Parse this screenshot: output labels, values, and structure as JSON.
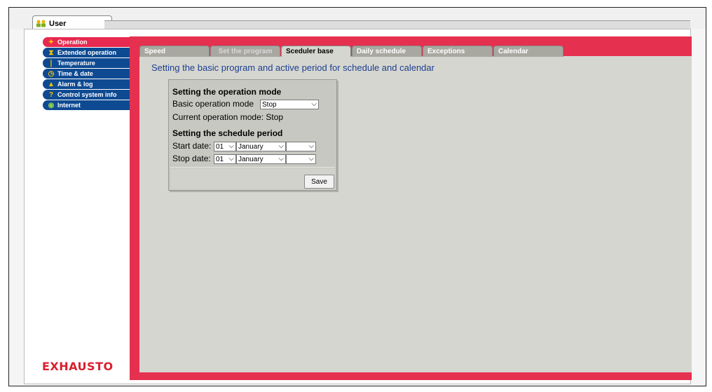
{
  "window": {
    "tab_label": "User"
  },
  "sidebar": {
    "items": [
      {
        "label": "Operation",
        "icon": "tools-icon",
        "glyph": "🔧"
      },
      {
        "label": "Extended operation",
        "icon": "hourglass-icon",
        "glyph": "⧗"
      },
      {
        "label": "Temperature",
        "icon": "thermometer-icon",
        "glyph": "🌡"
      },
      {
        "label": "Time & date",
        "icon": "clock-icon",
        "glyph": "◷"
      },
      {
        "label": "Alarm & log",
        "icon": "bell-icon",
        "glyph": "🔔"
      },
      {
        "label": "Control system info",
        "icon": "question-icon",
        "glyph": "?"
      },
      {
        "label": "Internet",
        "icon": "globe-icon",
        "glyph": "◉"
      }
    ]
  },
  "tabs": [
    {
      "label": "Speed"
    },
    {
      "label": "Set the program"
    },
    {
      "label": "Sceduler base"
    },
    {
      "label": "Daily schedule"
    },
    {
      "label": "Exceptions"
    },
    {
      "label": "Calendar"
    }
  ],
  "page": {
    "title": "Setting the basic program and active period for schedule and calendar"
  },
  "operation_mode": {
    "heading": "Setting the operation mode",
    "basic_label": "Basic operation mode",
    "basic_value": "Stop",
    "current_text": "Current operation mode: Stop"
  },
  "schedule_period": {
    "heading": "Setting the schedule period",
    "start_label": "Start date:",
    "start_day": "01",
    "start_month": "January",
    "start_year": "",
    "stop_label": "Stop date:",
    "stop_day": "01",
    "stop_month": "January",
    "stop_year": ""
  },
  "buttons": {
    "save": "Save"
  },
  "brand": {
    "logo": "EXHAUSTO"
  },
  "colors": {
    "sidebar_blue": "#0e4a92",
    "active_red": "#e8294f",
    "frame_red": "#e5304f",
    "title_blue": "#1c3f8f",
    "logo_red": "#d8212f"
  }
}
